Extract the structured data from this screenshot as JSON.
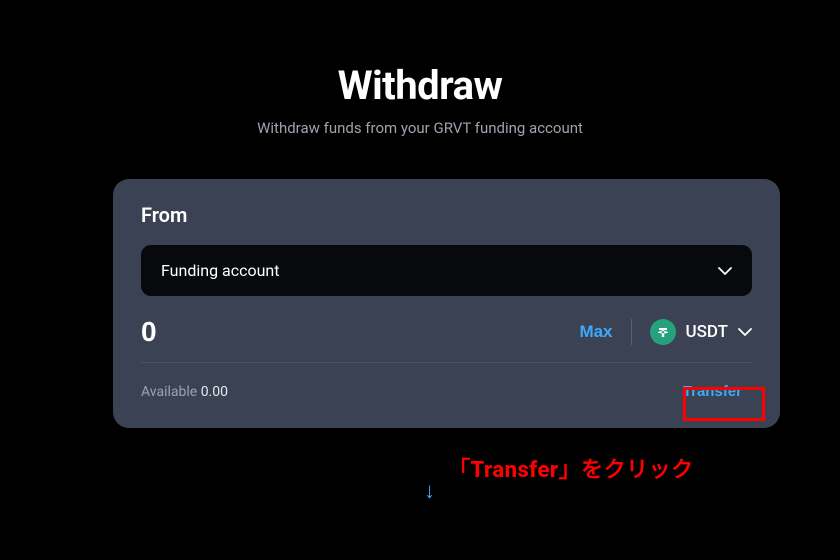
{
  "header": {
    "title": "Withdraw",
    "subtitle": "Withdraw funds from your GRVT funding account"
  },
  "card": {
    "from_label": "From",
    "account": {
      "selected": "Funding account"
    },
    "amount": {
      "value": "0",
      "max_label": "Max",
      "currency": "USDT"
    },
    "available": {
      "label": "Available",
      "value": "0.00"
    },
    "transfer_label": "Transfer"
  },
  "annotation": {
    "text": "「Transfer」をクリック",
    "arrow": "↓"
  }
}
